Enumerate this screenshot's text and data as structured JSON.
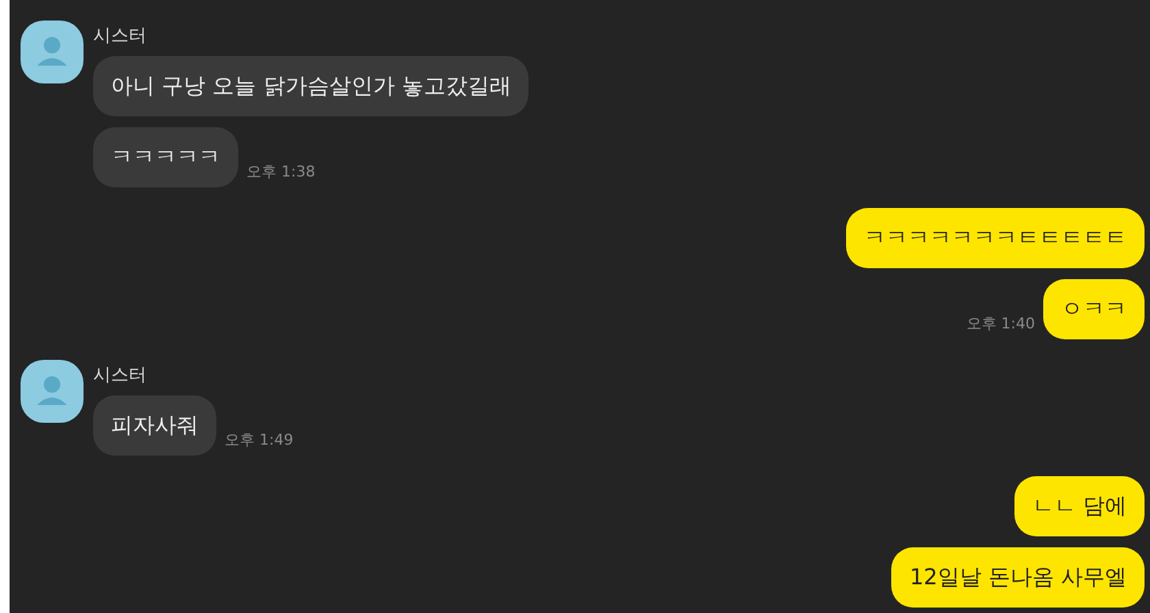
{
  "groups": [
    {
      "kind": "received",
      "sender": "시스터",
      "messages": [
        {
          "text": "아니 구낭 오늘 닭가슴살인가 놓고갔길래"
        },
        {
          "text": "ㅋㅋㅋㅋㅋ",
          "time": "오후 1:38"
        }
      ]
    },
    {
      "kind": "sent",
      "messages": [
        {
          "text": "ㅋㅋㅋㅋㅋㅋㅋㅌㅌㅌㅌㅌ"
        },
        {
          "text": "ㅇㅋㅋ",
          "time": "오후 1:40"
        }
      ]
    },
    {
      "kind": "received",
      "sender": "시스터",
      "messages": [
        {
          "text": "피자사줘",
          "time": "오후 1:49"
        }
      ]
    },
    {
      "kind": "sent",
      "messages": [
        {
          "text": "ㄴㄴ 담에"
        },
        {
          "text": "12일날 돈나옴 사무엘"
        }
      ]
    }
  ]
}
